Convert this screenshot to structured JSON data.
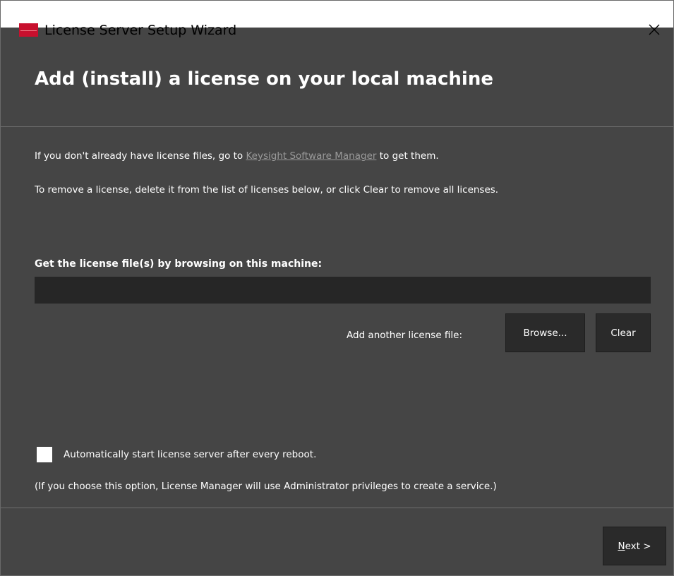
{
  "window": {
    "title": "License Server Setup Wizard",
    "close_icon": "close-icon",
    "app_icon": "keysight-app-icon"
  },
  "page": {
    "heading": "Add (install) a license on your local machine",
    "info_prefix": "If you don't already have license files, go to",
    "info_link": "Keysight Software Manager",
    "info_suffix": "to get them.",
    "info_remove": "To remove a license, delete it from the list of licenses below, or click Clear to remove all licenses."
  },
  "browse_section": {
    "label": "Get the license file(s) by browsing on this machine:",
    "file_value": "",
    "add_label": "Add another license file:",
    "browse_button": "Browse...",
    "clear_button": "Clear"
  },
  "autostart": {
    "checked": false,
    "label": "Automatically start license server after every reboot.",
    "note": "(If you choose this option, License Manager will use Administrator privileges to create a service.)"
  },
  "footer": {
    "next_mnemonic": "N",
    "next_rest": "ext >"
  },
  "colors": {
    "background": "#454545",
    "input_bg": "#262626",
    "button_bg": "#2a2a2a",
    "link": "#9a9a9a",
    "brand_red": "#c8102e"
  }
}
